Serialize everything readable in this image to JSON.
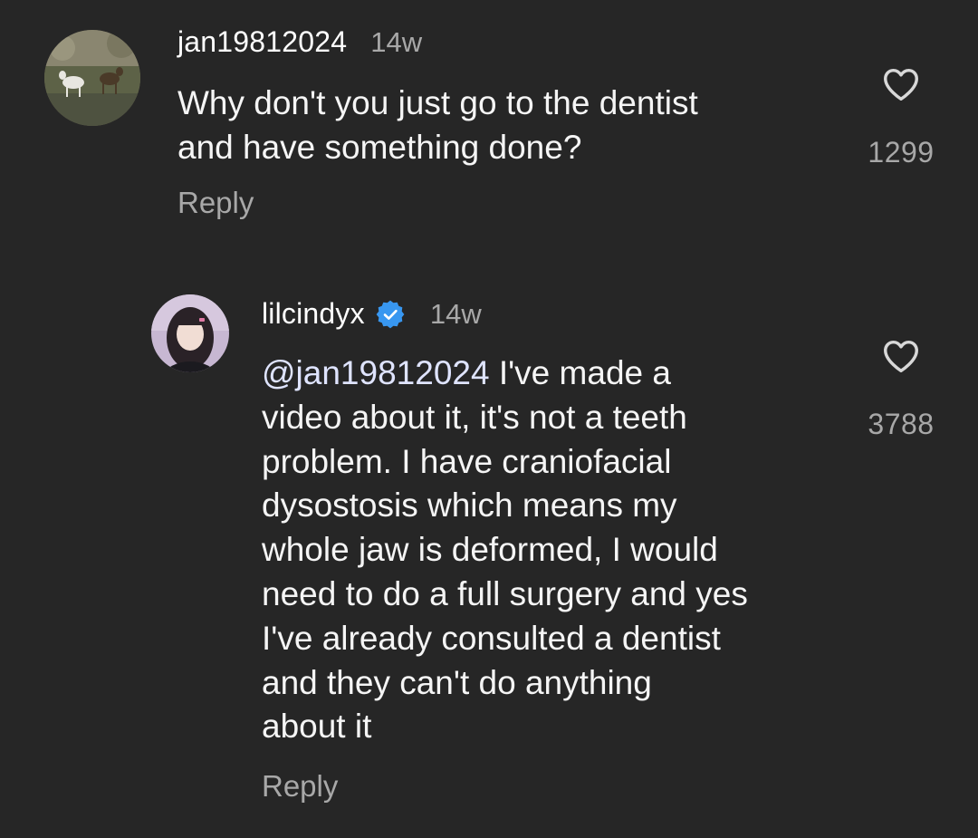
{
  "comments": [
    {
      "username": "jan19812024",
      "time": "14w",
      "text": "Why don't you just go to the dentist\nand have something done?",
      "reply_label": "Reply",
      "like_count": "1299",
      "avatar_icon": "deer-photo-avatar"
    },
    {
      "username": "lilcindyx",
      "verified": true,
      "time": "14w",
      "mention": "@jan19812024",
      "text": " I've made a\nvideo about it, it's not a teeth\nproblem. I have craniofacial\ndysostosis which means my\nwhole jaw is deformed, I would\nneed to do a full surgery and yes\nI've already consulted a dentist\nand they can't do anything\nabout it",
      "reply_label": "Reply",
      "like_count": "3788",
      "avatar_icon": "girl-portrait-avatar"
    }
  ],
  "colors": {
    "background": "#262626",
    "text": "#f5f5f5",
    "muted": "#a8a8a8",
    "verified_blue": "#3897f0",
    "mention": "#dfe4ff"
  },
  "icons": {
    "like": "heart-outline-icon",
    "verified": "verified-badge-icon"
  }
}
